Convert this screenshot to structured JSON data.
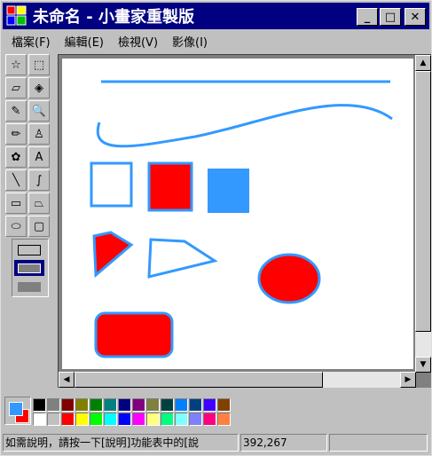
{
  "window": {
    "title": "未命名 - 小畫家重製版",
    "minimize_glyph": "_",
    "maximize_glyph": "□",
    "close_glyph": "✕"
  },
  "menu": [
    "檔案(F)",
    "編輯(E)",
    "檢視(V)",
    "影像(I)"
  ],
  "tools": [
    {
      "name": "free-select-icon",
      "glyph": "☆"
    },
    {
      "name": "rect-select-icon",
      "glyph": "⬚"
    },
    {
      "name": "eraser-icon",
      "glyph": "▱"
    },
    {
      "name": "fill-bucket-icon",
      "glyph": "◈"
    },
    {
      "name": "eyedropper-icon",
      "glyph": "✎"
    },
    {
      "name": "magnifier-icon",
      "glyph": "🔍"
    },
    {
      "name": "pencil-icon",
      "glyph": "✏"
    },
    {
      "name": "brush-icon",
      "glyph": "♙"
    },
    {
      "name": "airbrush-icon",
      "glyph": "✿"
    },
    {
      "name": "text-icon",
      "glyph": "A"
    },
    {
      "name": "line-icon",
      "glyph": "╲"
    },
    {
      "name": "curve-icon",
      "glyph": "∫"
    },
    {
      "name": "rectangle-icon",
      "glyph": "▭"
    },
    {
      "name": "polygon-icon",
      "glyph": "⏢"
    },
    {
      "name": "ellipse-icon",
      "glyph": "⬭"
    },
    {
      "name": "rounded-rect-icon",
      "glyph": "▢"
    }
  ],
  "colors": {
    "outline": "#3399ff",
    "fill": "#ff0000",
    "selected_fill_style_bg": "#000080"
  },
  "palette_top": [
    "#000000",
    "#808080",
    "#800000",
    "#808000",
    "#008000",
    "#008080",
    "#000080",
    "#800080",
    "#808040",
    "#004040",
    "#0080ff",
    "#004080",
    "#4000ff",
    "#804000"
  ],
  "palette_bottom": [
    "#ffffff",
    "#c0c0c0",
    "#ff0000",
    "#ffff00",
    "#00ff00",
    "#00ffff",
    "#0000ff",
    "#ff00ff",
    "#ffff80",
    "#00ff80",
    "#80ffff",
    "#8080ff",
    "#ff0080",
    "#ff8040"
  ],
  "status": {
    "help": "如需說明，請按一下[說明]功能表中的[說",
    "coords": "392,267",
    "size": ""
  }
}
